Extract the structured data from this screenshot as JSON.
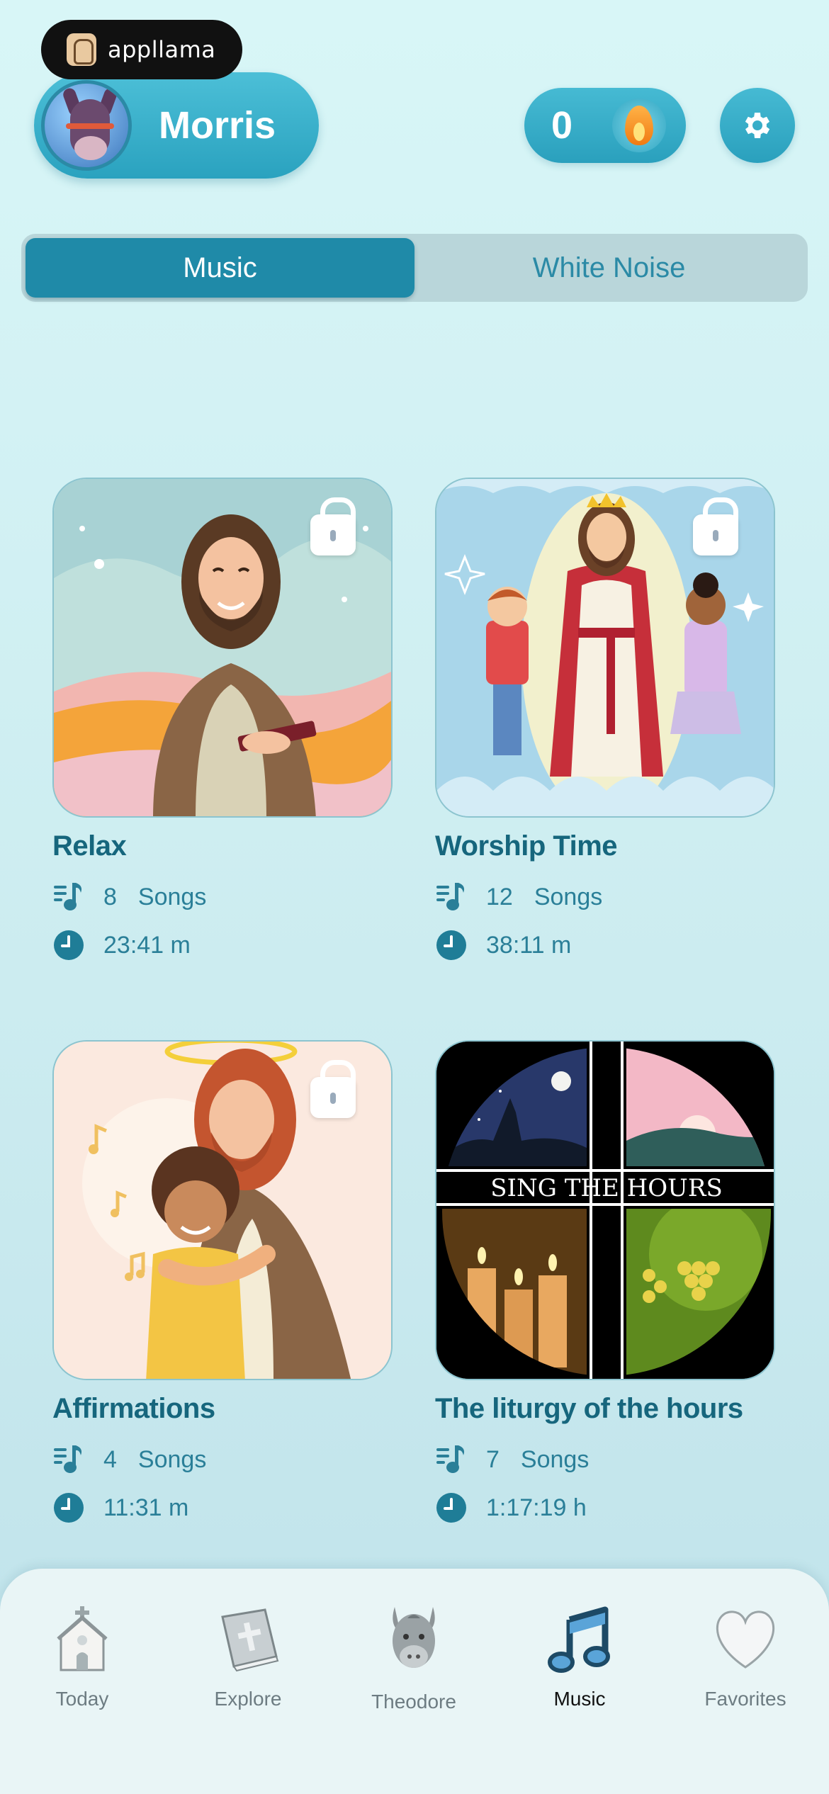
{
  "watermark": {
    "text": "appllama"
  },
  "profile": {
    "name": "Morris"
  },
  "streak": {
    "count": "0"
  },
  "tabs": [
    {
      "label": "Music",
      "active": true
    },
    {
      "label": "White Noise",
      "active": false
    }
  ],
  "playlists": [
    {
      "title": "Relax",
      "songs_count": "8",
      "songs_label": "Songs",
      "duration": "23:41 m",
      "locked": true
    },
    {
      "title": "Worship Time",
      "songs_count": "12",
      "songs_label": "Songs",
      "duration": "38:11 m",
      "locked": true
    },
    {
      "title": "Affirmations",
      "songs_count": "4",
      "songs_label": "Songs",
      "duration": "11:31 m",
      "locked": true
    },
    {
      "title": "The liturgy of the hours",
      "songs_count": "7",
      "songs_label": "Songs",
      "duration": "1:17:19 h",
      "locked": false,
      "art_text": "SING THE HOURS"
    }
  ],
  "nav": [
    {
      "label": "Today",
      "icon": "church-icon"
    },
    {
      "label": "Explore",
      "icon": "bible-icon"
    },
    {
      "label": "Theodore",
      "icon": "donkey-icon"
    },
    {
      "label": "Music",
      "icon": "music-note-icon",
      "active": true
    },
    {
      "label": "Favorites",
      "icon": "heart-icon"
    }
  ],
  "colors": {
    "accent": "#1f8aa8",
    "title": "#16667d",
    "background": "#d8f6f7"
  }
}
